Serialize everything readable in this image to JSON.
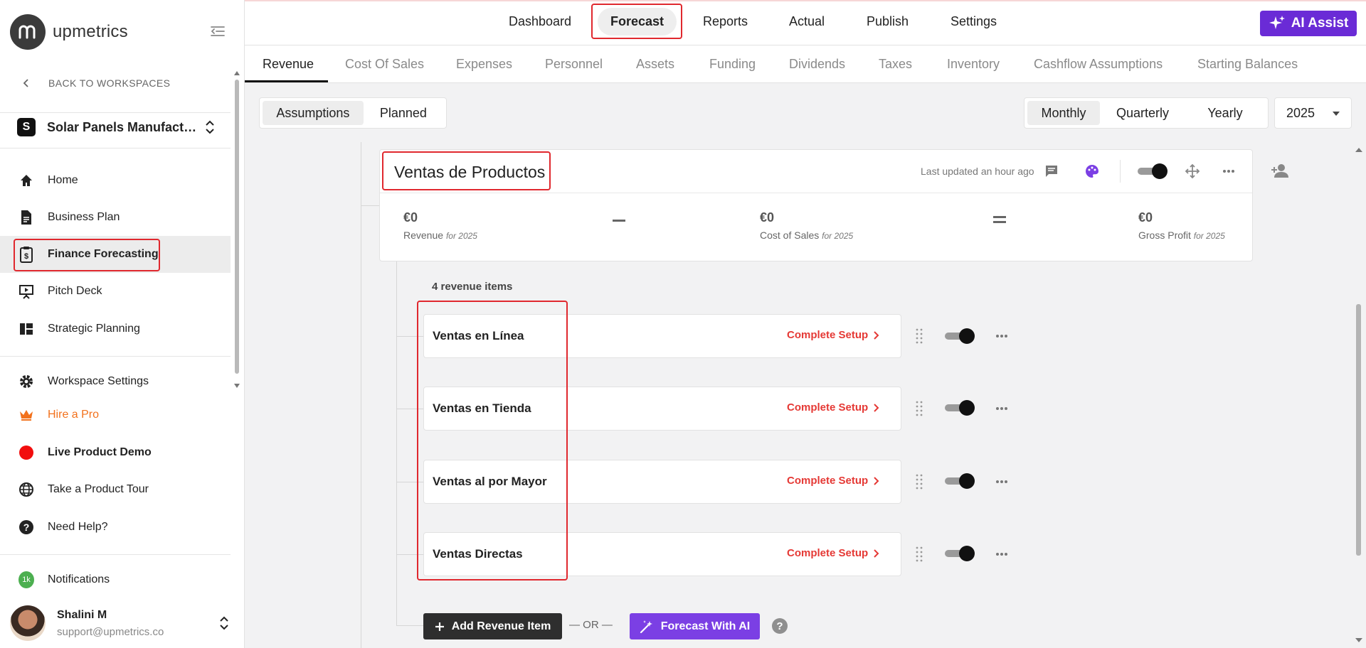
{
  "app": {
    "brand": "upmetrics"
  },
  "sidebar": {
    "back_label": "BACK TO WORKSPACES",
    "workspace": {
      "initial": "S",
      "name": "Solar Panels Manufacturing"
    },
    "nav": [
      {
        "label": "Home",
        "icon": "home-icon"
      },
      {
        "label": "Business Plan",
        "icon": "document-icon"
      },
      {
        "label": "Finance Forecasting",
        "icon": "finance-clipboard-icon"
      },
      {
        "label": "Pitch Deck",
        "icon": "presentation-icon"
      },
      {
        "label": "Strategic Planning",
        "icon": "dashboard-grid-icon"
      }
    ],
    "secondary": [
      {
        "label": "Workspace Settings",
        "icon": "gear-icon"
      },
      {
        "label": "Hire a Pro",
        "icon": "crown-icon"
      },
      {
        "label": "Live Product Demo",
        "icon": "live-dot-icon"
      },
      {
        "label": "Take a Product Tour",
        "icon": "globe-icon"
      },
      {
        "label": "Need Help?",
        "icon": "question-icon"
      }
    ],
    "notifications": {
      "label": "Notifications",
      "badge": "1k"
    },
    "user": {
      "name": "Shalini M",
      "email": "support@upmetrics.co"
    }
  },
  "topbar": {
    "tabs": [
      "Dashboard",
      "Forecast",
      "Reports",
      "Actual",
      "Publish",
      "Settings"
    ],
    "active_tab": "Forecast",
    "ai_assist_label": "AI Assist"
  },
  "subtabs": {
    "items": [
      "Revenue",
      "Cost Of Sales",
      "Expenses",
      "Personnel",
      "Assets",
      "Funding",
      "Dividends",
      "Taxes",
      "Inventory",
      "Cashflow Assumptions",
      "Starting Balances"
    ],
    "active": "Revenue"
  },
  "controls": {
    "view_modes": [
      "Assumptions",
      "Planned"
    ],
    "active_view": "Assumptions",
    "periods": [
      "Monthly",
      "Quarterly",
      "Yearly"
    ],
    "active_period": "Monthly",
    "year": "2025"
  },
  "card": {
    "title": "Ventas de Productos",
    "last_updated": "Last updated an hour ago",
    "metrics": [
      {
        "value": "€0",
        "label": "Revenue",
        "suffix": "for 2025"
      },
      {
        "value": "€0",
        "label": "Cost of Sales",
        "suffix": "for 2025"
      },
      {
        "value": "€0",
        "label": "Gross Profit",
        "suffix": "for 2025"
      }
    ]
  },
  "revenue_items": {
    "count_label": "4 revenue items",
    "setup_label": "Complete Setup",
    "items": [
      {
        "name": "Ventas en Línea",
        "enabled": true
      },
      {
        "name": "Ventas en Tienda",
        "enabled": true
      },
      {
        "name": "Ventas al por Mayor",
        "enabled": true
      },
      {
        "name": "Ventas Directas",
        "enabled": true
      }
    ]
  },
  "actions": {
    "add_label": "Add Revenue Item",
    "or_label": "OR",
    "ai_label": "Forecast With AI",
    "help": "?"
  },
  "colors": {
    "accent_purple": "#6a2bd6",
    "setup_red": "#e53935",
    "highlight_red": "#e0282e"
  }
}
